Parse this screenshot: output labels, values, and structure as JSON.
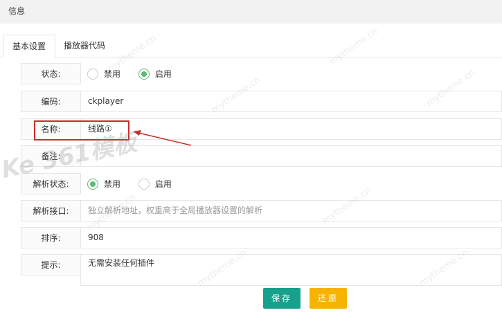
{
  "topbar": {
    "title": "信息"
  },
  "tabs": [
    {
      "label": "基本设置",
      "active": true
    },
    {
      "label": "播放器代码",
      "active": false
    }
  ],
  "form": {
    "status": {
      "label": "状态:",
      "options": [
        "禁用",
        "启用"
      ],
      "selected": "启用"
    },
    "code": {
      "label": "编码:",
      "value": "ckplayer"
    },
    "name": {
      "label": "名称:",
      "value": "线路①"
    },
    "remark": {
      "label": "备注:",
      "value": ""
    },
    "parse_status": {
      "label": "解析状态:",
      "options": [
        "禁用",
        "启用"
      ],
      "selected": "禁用"
    },
    "parse_api": {
      "label": "解析接口:",
      "value": "",
      "placeholder": "独立解析地址，权重高于全局播放器设置的解析"
    },
    "order": {
      "label": "排序:",
      "value": "908"
    },
    "tip": {
      "label": "提示:",
      "value": "无需安装任何插件"
    }
  },
  "buttons": {
    "save": "保存",
    "reset": "还原"
  },
  "watermark": {
    "text": "mytheme.cn",
    "logo": "Ke 361模板"
  },
  "colors": {
    "accent_green": "#5fb878",
    "save_bg": "#17a08c",
    "reset_bg": "#f6b400",
    "highlight": "#cc2929"
  }
}
